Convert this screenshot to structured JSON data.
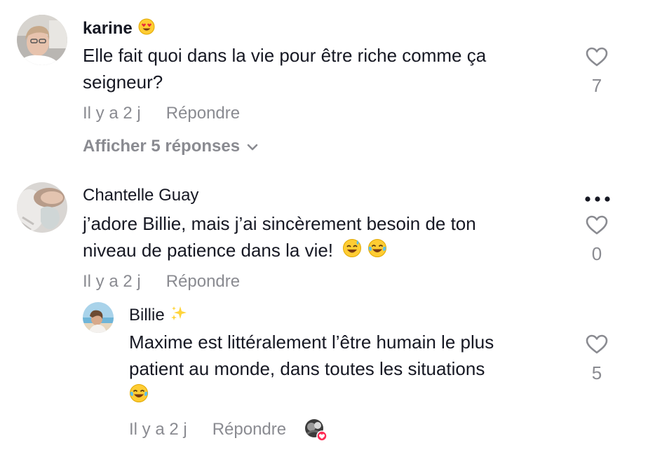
{
  "comments": [
    {
      "username": "karine",
      "username_emoji": "heart-eyes-emoji",
      "text_line1": "Elle fait quoi dans la vie pour être riche comme ça",
      "text_line2": "seigneur?",
      "time": "Il y a 2 j",
      "reply_label": "Répondre",
      "likes": "7",
      "view_replies": "Afficher 5 réponses"
    },
    {
      "username": "Chantelle Guay",
      "text_line1": "j’adore Billie, mais j’ai sincèrement besoin de ton",
      "text_line2": "niveau de patience dans la vie!",
      "text_emoji": [
        "sweat-smile-emoji",
        "joy-emoji"
      ],
      "time": "Il y a 2 j",
      "reply_label": "Répondre",
      "likes": "0",
      "more_icon": "ellipsis-icon"
    }
  ],
  "reply": {
    "username": "Billie",
    "username_emoji": "sparkles-emoji",
    "text_line1": "Maxime est littéralement l’être humain le plus",
    "text_line2": "patient au monde, dans toutes les situations",
    "text_emoji": "joy-emoji",
    "time": "Il y a 2 j",
    "reply_label": "Répondre",
    "likes": "5",
    "creator_liked_icon": "creator-liked-avatar-heart"
  },
  "colors": {
    "text": "#161823",
    "secondary": "#8a8b91",
    "accent": "#fe2c55"
  }
}
